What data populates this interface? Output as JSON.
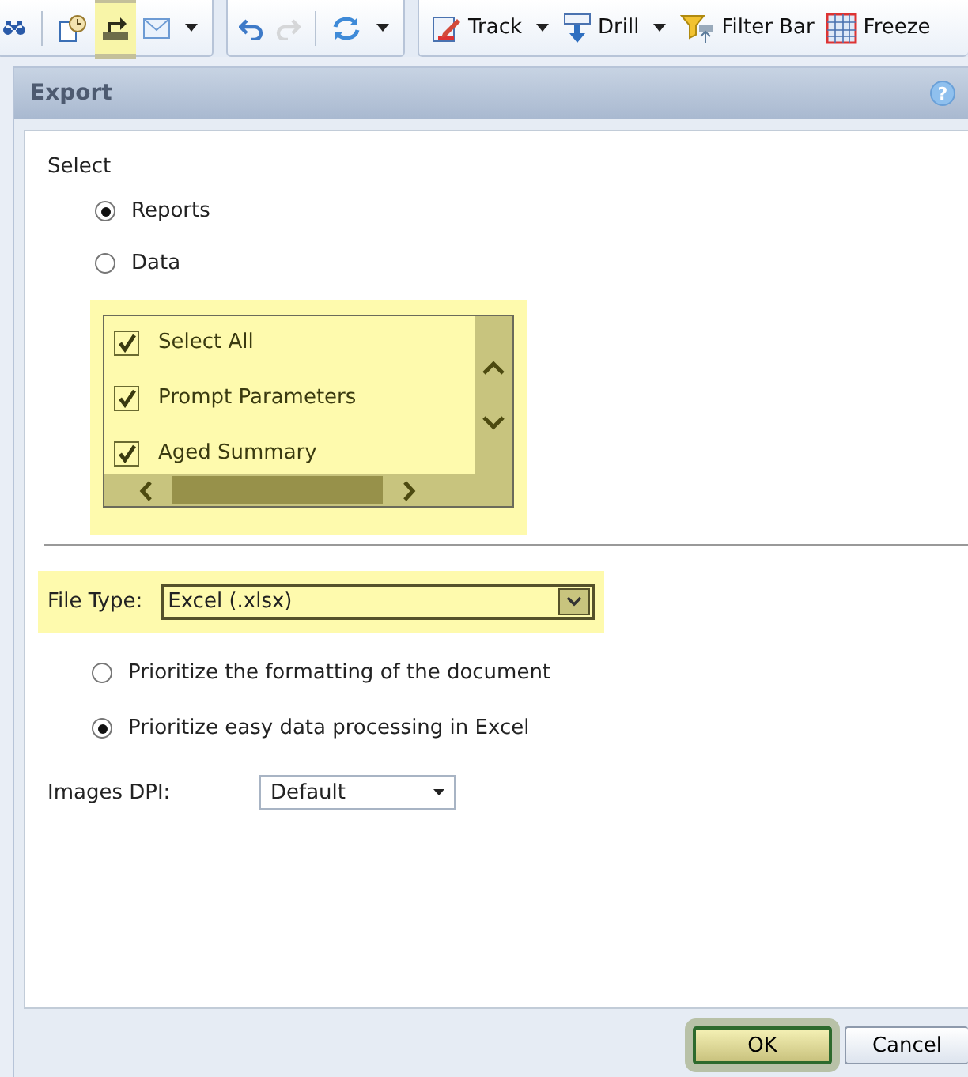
{
  "toolbar": {
    "groups": [
      {
        "items": [
          {
            "kind": "binoculars",
            "highlighted": false,
            "disabled": false
          },
          {
            "kind": "separator"
          },
          {
            "kind": "schedule",
            "highlighted": false,
            "disabled": false
          },
          {
            "kind": "export",
            "highlighted": true,
            "disabled": false
          },
          {
            "kind": "email",
            "highlighted": false,
            "disabled": false
          },
          {
            "kind": "dropdown",
            "highlighted": false,
            "disabled": false
          }
        ]
      },
      {
        "items": [
          {
            "kind": "undo",
            "highlighted": false,
            "disabled": false
          },
          {
            "kind": "redo",
            "highlighted": false,
            "disabled": true
          },
          {
            "kind": "separator"
          },
          {
            "kind": "refresh",
            "highlighted": false,
            "disabled": false
          },
          {
            "kind": "dropdown",
            "highlighted": false,
            "disabled": false
          }
        ]
      },
      {
        "items": [
          {
            "kind": "track",
            "label": "Track",
            "highlighted": false,
            "disabled": false
          },
          {
            "kind": "dropdown",
            "highlighted": false,
            "disabled": false
          },
          {
            "kind": "drill",
            "label": "Drill",
            "highlighted": false,
            "disabled": false
          },
          {
            "kind": "dropdown",
            "highlighted": false,
            "disabled": false
          },
          {
            "kind": "filter",
            "label": "Filter Bar",
            "highlighted": false,
            "disabled": false
          },
          {
            "kind": "freeze",
            "label": "Freeze",
            "highlighted": false,
            "disabled": false
          }
        ]
      }
    ]
  },
  "dialog": {
    "title": "Export",
    "help": "?",
    "select_label": "Select",
    "mode_options": [
      {
        "label": "Reports",
        "selected": true
      },
      {
        "label": "Data",
        "selected": false
      }
    ],
    "report_list": {
      "highlighted": true,
      "items": [
        {
          "label": "Select All",
          "checked": true
        },
        {
          "label": "Prompt Parameters",
          "checked": true
        },
        {
          "label": "Aged Summary",
          "checked": true
        }
      ]
    },
    "file_type": {
      "label": "File Type:",
      "value": "Excel (.xlsx)",
      "highlighted": true
    },
    "excel_options": [
      {
        "label": "Prioritize the formatting of the document",
        "selected": false
      },
      {
        "label": "Prioritize easy data processing in Excel",
        "selected": true
      }
    ],
    "images_dpi": {
      "label": "Images DPI:",
      "value": "Default"
    },
    "buttons": [
      {
        "label": "OK",
        "highlighted": true
      },
      {
        "label": "Cancel",
        "highlighted": false
      }
    ]
  }
}
